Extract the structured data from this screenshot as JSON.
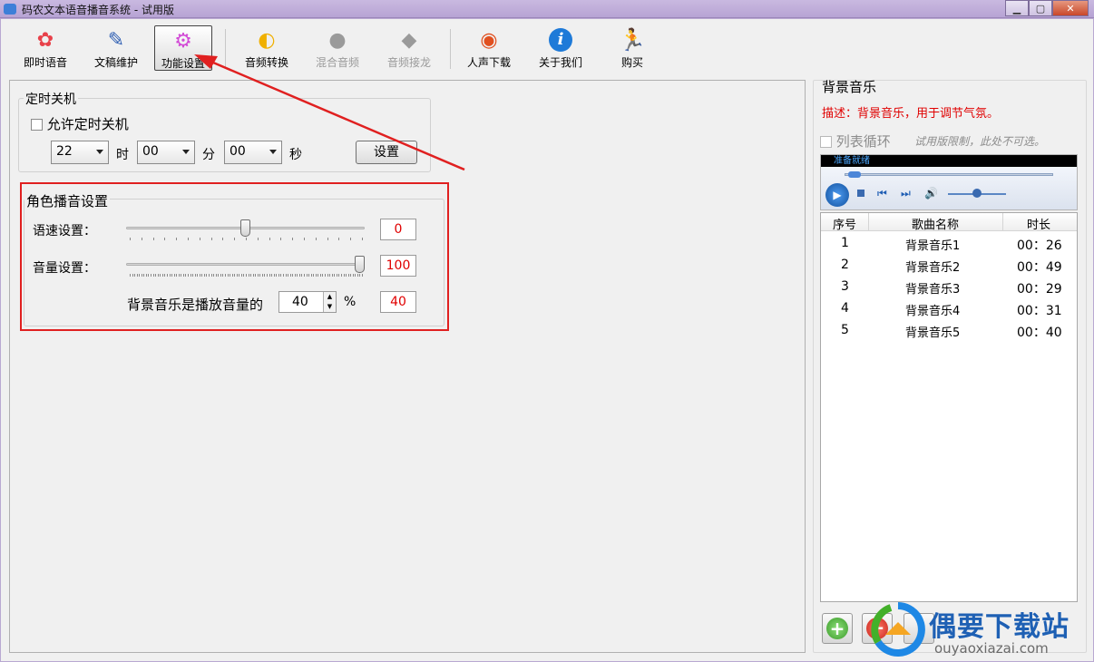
{
  "window": {
    "title": "码农文本语音播音系统 - 试用版",
    "min": "▁",
    "max": "▢",
    "close": "✕"
  },
  "toolbar": [
    {
      "label": "即时语音",
      "icon": "flower-icon",
      "color": "#e8414a",
      "glyph": "✿"
    },
    {
      "label": "文稿维护",
      "icon": "document-pencil-icon",
      "color": "#2f5fb3",
      "glyph": "✎"
    },
    {
      "label": "功能设置",
      "icon": "gear-icon",
      "color": "#d24bd6",
      "glyph": "⚙"
    },
    {
      "label": "音频转换",
      "icon": "audio-convert-icon",
      "color": "#f0b000",
      "glyph": "◐"
    },
    {
      "label": "混合音频",
      "icon": "mix-audio-icon",
      "color": "#9a9a9a",
      "glyph": "●"
    },
    {
      "label": "音频接龙",
      "icon": "audio-chain-icon",
      "color": "#9a9a9a",
      "glyph": "◆"
    },
    {
      "label": "人声下载",
      "icon": "voice-download-icon",
      "color": "#e05020",
      "glyph": "◉"
    },
    {
      "label": "关于我们",
      "icon": "info-icon",
      "color": "#1e7ad8",
      "glyph": "i"
    },
    {
      "label": "购买",
      "icon": "running-man-icon",
      "color": "#5a3fd0",
      "glyph": "🏃"
    }
  ],
  "timer": {
    "group_title": "定时关机",
    "allow_label": "允许定时关机",
    "hour": "22",
    "hour_unit": "时",
    "minute": "00",
    "minute_unit": "分",
    "second": "00",
    "second_unit": "秒",
    "set_button": "设置"
  },
  "voice": {
    "group_title": "角色播音设置",
    "speed_label": "语速设置：",
    "speed_value": "0",
    "speed_level": 0.5,
    "volume_label": "音量设置：",
    "volume_value": "100",
    "volume_level": 1.0,
    "bgm_label": "背景音乐是播放音量的",
    "bgm_spin": "40",
    "bgm_unit": "%",
    "bgm_value": "40"
  },
  "bgm": {
    "title": "背景音乐",
    "desc": "描述：背景音乐，用于调节气氛。",
    "loop_label": "列表循环",
    "trial_note": "试用版限制，此处不可选。",
    "player_status": "准备就绪",
    "columns": [
      "序号",
      "歌曲名称",
      "时长"
    ],
    "rows": [
      {
        "no": "1",
        "name": "背景音乐1",
        "time": "00：26"
      },
      {
        "no": "2",
        "name": "背景音乐2",
        "time": "00：49"
      },
      {
        "no": "3",
        "name": "背景音乐3",
        "time": "00：29"
      },
      {
        "no": "4",
        "name": "背景音乐4",
        "time": "00：31"
      },
      {
        "no": "5",
        "name": "背景音乐5",
        "time": "00：40"
      }
    ]
  },
  "watermark": {
    "brand": "偶要下载站",
    "url": "ouyaoxiazai.com"
  },
  "colors": {
    "accent_red": "#e02020",
    "value_red": "#e00000",
    "desc_red": "#e00000"
  }
}
